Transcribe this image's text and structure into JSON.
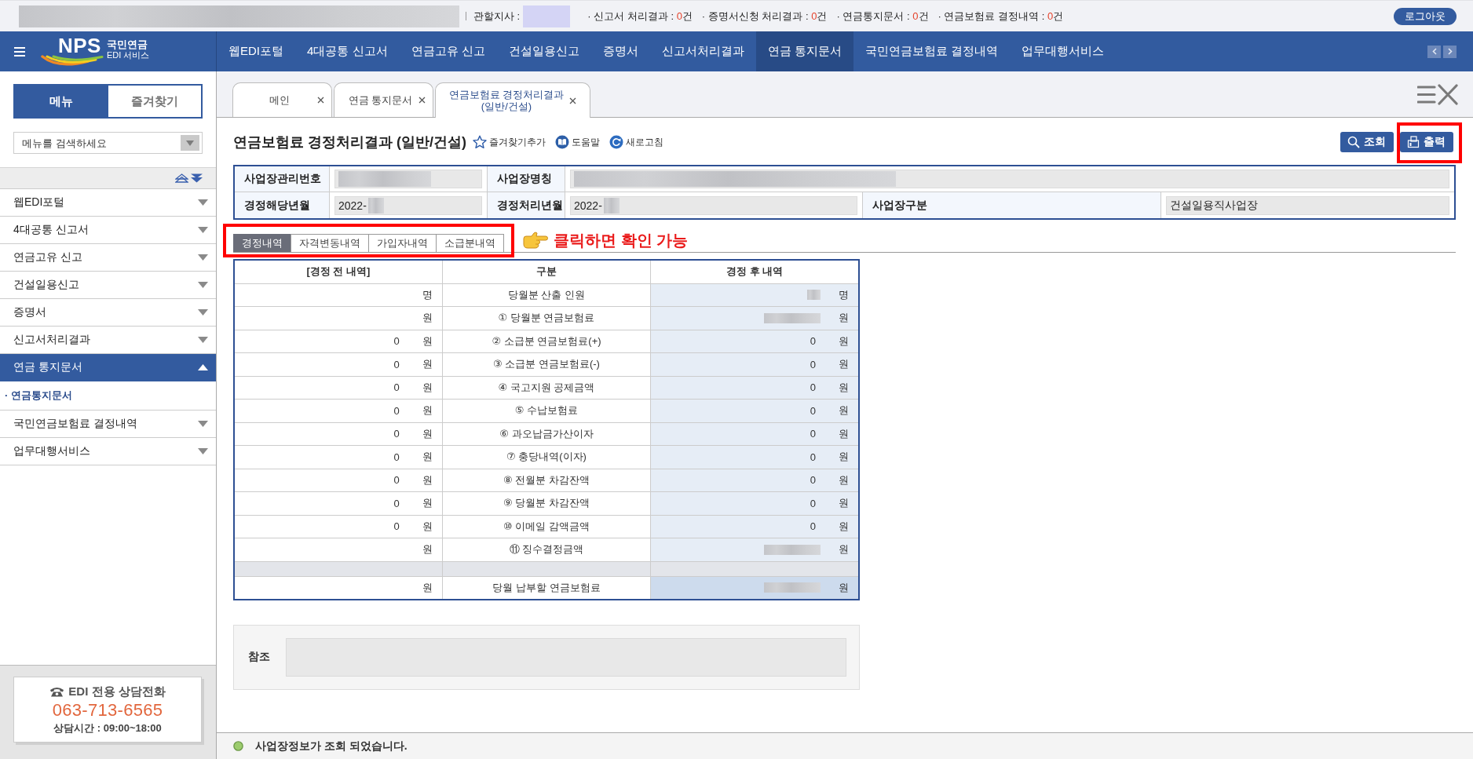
{
  "top_bar": {
    "user_info_blurred": true,
    "branch": {
      "label": "관할지사 :",
      "blurred": true
    },
    "counters": [
      {
        "label": "· 신고서 처리결과 :",
        "count": "0",
        "unit": "건"
      },
      {
        "label": "· 증명서신청 처리결과 :",
        "count": "0",
        "unit": "건"
      },
      {
        "label": "· 연금통지문서 :",
        "count": "0",
        "unit": "건"
      },
      {
        "label": "· 연금보험료 결정내역 :",
        "count": "0",
        "unit": "건"
      }
    ],
    "logout": "로그아웃"
  },
  "logo": {
    "mark": "NPS",
    "name": "국민연금",
    "service": "EDI 서비스"
  },
  "nav": [
    {
      "label": "웹EDI포털",
      "selected": false
    },
    {
      "label": "4대공통 신고서",
      "selected": false
    },
    {
      "label": "연금고유 신고",
      "selected": false
    },
    {
      "label": "건설일용신고",
      "selected": false
    },
    {
      "label": "증명서",
      "selected": false
    },
    {
      "label": "신고서처리결과",
      "selected": false
    },
    {
      "label": "연금 통지문서",
      "selected": true
    },
    {
      "label": "국민연금보험료 결정내역",
      "selected": false
    },
    {
      "label": "업무대행서비스",
      "selected": false
    }
  ],
  "sidebar": {
    "tabs": [
      {
        "label": "메뉴",
        "selected": true
      },
      {
        "label": "즐겨찾기",
        "selected": false
      }
    ],
    "search": {
      "placeholder": "메뉴를 검색하세요"
    },
    "items": [
      {
        "label": "웹EDI포털",
        "expanded": false
      },
      {
        "label": "4대공통 신고서",
        "expanded": false
      },
      {
        "label": "연금고유 신고",
        "expanded": false
      },
      {
        "label": "건설일용신고",
        "expanded": false
      },
      {
        "label": "증명서",
        "expanded": false
      },
      {
        "label": "신고서처리결과",
        "expanded": false
      },
      {
        "label": "연금 통지문서",
        "expanded": true,
        "children": [
          {
            "label": "· 연금통지문서",
            "selected": true
          }
        ]
      },
      {
        "label": "국민연금보험료 결정내역",
        "expanded": false
      },
      {
        "label": "업무대행서비스",
        "expanded": false
      }
    ],
    "contact": {
      "title": "EDI 전용 상담전화",
      "phone": "063-713-6565",
      "hours": "상담시간 : 09:00~18:00"
    }
  },
  "tabs": [
    {
      "label": "메인",
      "selected": false
    },
    {
      "label": "연금 통지문서",
      "selected": false
    },
    {
      "label": "연금보험료 경정처리결과 (일반/건설)",
      "selected": true
    }
  ],
  "page": {
    "title": "연금보험료 경정처리결과 (일반/건설)",
    "links": [
      {
        "kind": "favorite",
        "label": "즐겨찾기추가"
      },
      {
        "kind": "help",
        "label": "도움말"
      },
      {
        "kind": "refresh",
        "label": "새로고침"
      }
    ],
    "actions": [
      {
        "kind": "search",
        "label": "조회",
        "highlighted": false
      },
      {
        "kind": "print",
        "label": "출력",
        "highlighted": true
      }
    ]
  },
  "business_info": {
    "fields": [
      {
        "label": "사업장관리번호",
        "blurred": true
      },
      {
        "label": "사업장명칭",
        "blurred": true
      },
      {
        "label": "경정해당년월",
        "value": "2022-",
        "blurred": true
      },
      {
        "label": "경정처리년월",
        "value": "2022-",
        "blurred": true
      },
      {
        "label": "사업장구분",
        "value": "건설일용직사업장",
        "blurred": false
      }
    ]
  },
  "detail_tabs": {
    "highlighted": true,
    "items": [
      {
        "label": "경정내역",
        "selected": true
      },
      {
        "label": "자격변동내역",
        "selected": false
      },
      {
        "label": "가입자내역",
        "selected": false
      },
      {
        "label": "소급분내역",
        "selected": false
      }
    ]
  },
  "annotation": {
    "text": "클릭하면 확인 가능"
  },
  "result_table": {
    "columns": [
      "[경정 전 내역]",
      "구분",
      "경정 후 내역"
    ],
    "rows": [
      {
        "kind": "item",
        "before": {
          "unit": "명"
        },
        "label": "당월분 산출 인원",
        "after": {
          "blurred": true,
          "unit": "명"
        }
      },
      {
        "kind": "item",
        "before": {
          "unit": "원"
        },
        "label": "① 당월분 연금보험료",
        "after": {
          "blurred": true,
          "unit": "원"
        }
      },
      {
        "kind": "item",
        "before": {
          "value": "0",
          "unit": "원"
        },
        "label": "② 소급분 연금보험료(+)",
        "after": {
          "value": "0",
          "blurred": false,
          "unit": "원"
        }
      },
      {
        "kind": "item",
        "before": {
          "value": "0",
          "unit": "원"
        },
        "label": "③ 소급분 연금보험료(-)",
        "after": {
          "value": "0",
          "blurred": false,
          "unit": "원"
        }
      },
      {
        "kind": "item",
        "before": {
          "value": "0",
          "unit": "원"
        },
        "label": "④ 국고지원 공제금액",
        "after": {
          "value": "0",
          "blurred": false,
          "unit": "원"
        }
      },
      {
        "kind": "item",
        "before": {
          "value": "0",
          "unit": "원"
        },
        "label": "⑤ 수납보험료",
        "after": {
          "value": "0",
          "blurred": false,
          "unit": "원"
        }
      },
      {
        "kind": "item",
        "before": {
          "value": "0",
          "unit": "원"
        },
        "label": "⑥ 과오납금가산이자",
        "after": {
          "value": "0",
          "blurred": false,
          "unit": "원"
        }
      },
      {
        "kind": "item",
        "before": {
          "value": "0",
          "unit": "원"
        },
        "label": "⑦ 충당내역(이자)",
        "after": {
          "value": "0",
          "blurred": false,
          "unit": "원"
        }
      },
      {
        "kind": "item",
        "before": {
          "value": "0",
          "unit": "원"
        },
        "label": "⑧ 전월분 차감잔액",
        "after": {
          "value": "0",
          "blurred": false,
          "unit": "원"
        }
      },
      {
        "kind": "item",
        "before": {
          "value": "0",
          "unit": "원"
        },
        "label": "⑨ 당월분 차감잔액",
        "after": {
          "value": "0",
          "blurred": false,
          "unit": "원"
        }
      },
      {
        "kind": "item",
        "before": {
          "value": "0",
          "unit": "원"
        },
        "label": "⑩ 이메일 감액금액",
        "after": {
          "value": "0",
          "blurred": false,
          "unit": "원"
        }
      },
      {
        "kind": "item",
        "before": {
          "unit": "원"
        },
        "label": "⑪ 징수결정금액",
        "after": {
          "blurred": true,
          "unit": "원"
        }
      },
      {
        "kind": "spacer"
      },
      {
        "kind": "total",
        "before": {
          "unit": "원"
        },
        "label": "당월 납부할 연금보험료",
        "after": {
          "blurred": true,
          "unit": "원"
        }
      }
    ]
  },
  "reference": {
    "label": "참조"
  },
  "status_bar": {
    "message": "사업장정보가 조회 되었습니다."
  }
}
